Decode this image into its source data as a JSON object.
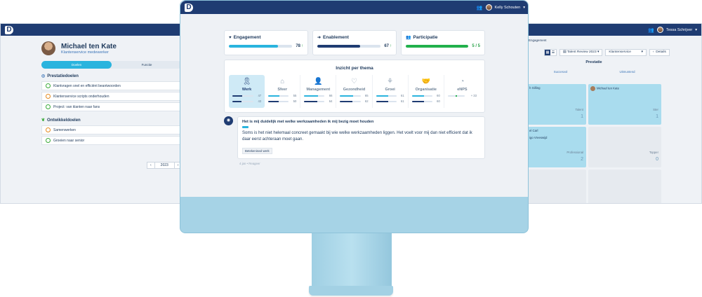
{
  "left": {
    "user_name": "Tessa Schrijver",
    "profile_name": "Michael ten Kate",
    "profile_role": "Klantenservice medewerker",
    "toggle": [
      "Doelen",
      "Functie"
    ],
    "sec1": "Prestatiedoelen",
    "goals1": [
      {
        "label": "Klantvragen snel en efficiënt beantwoorden",
        "mood": "green"
      },
      {
        "label": "Klantenservice scripts onderhouden",
        "mood": "orange"
      },
      {
        "label": "Project: van klanten naar fans",
        "mood": "green"
      }
    ],
    "sec2": "Ontwikkeldoelen",
    "goals2": [
      {
        "label": "Samenwerken",
        "mood": "orange"
      },
      {
        "label": "Groeien naar senior",
        "mood": "green"
      }
    ],
    "year": "2023"
  },
  "right": {
    "user_name": "Tessa Schrijver",
    "crumb": "Engagement",
    "review": "Talent Review 2023",
    "dept": "Klantenservice",
    "details": "Details",
    "title": "Prestatie",
    "cols": [
      "Succesvol",
      "Uitmuntend"
    ],
    "cells": [
      {
        "name": "h Gilling",
        "label": "Talent",
        "count": "1",
        "blue": true
      },
      {
        "name": "Michael ten Kate",
        "label": "Ster",
        "count": "1",
        "blue": true
      },
      {
        "name": "el Carl\n\nigo Vreeswijd",
        "label": "Professional",
        "count": "2",
        "blue": true
      },
      {
        "name": "",
        "label": "Topper",
        "count": "0",
        "blue": false
      },
      {
        "name": "",
        "label": "Gemiddelde medewerker",
        "count": "",
        "blue": false
      },
      {
        "name": "",
        "label": "Specialist",
        "count": "",
        "blue": false
      }
    ]
  },
  "main": {
    "user_name": "Kelly Schouten",
    "metrics": [
      {
        "title": "Engagement",
        "value": "78",
        "fraction": 0.78,
        "color": "#2ab4de",
        "icon": "heart-icon"
      },
      {
        "title": "Enablement",
        "value": "67",
        "fraction": 0.67,
        "color": "#1f3c72",
        "icon": "login-icon"
      },
      {
        "title": "Participatie",
        "value": "5 / 5",
        "fraction": 1.0,
        "color": "#22b14c",
        "icon": "people-icon"
      }
    ],
    "themes_title": "Inzicht per thema",
    "themes": [
      {
        "name": "Werk",
        "a": 47,
        "b": 43,
        "selected": true,
        "icon": "ribbon-icon"
      },
      {
        "name": "Sfeer",
        "a": 55,
        "b": 50,
        "selected": false,
        "icon": "home-icon"
      },
      {
        "name": "Management",
        "a": 66,
        "b": 64,
        "selected": false,
        "icon": "person-icon"
      },
      {
        "name": "Gezondheid",
        "a": 65,
        "b": 62,
        "selected": false,
        "icon": "heartbeat-icon"
      },
      {
        "name": "Groei",
        "a": 61,
        "b": 61,
        "selected": false,
        "icon": "growth-icon"
      },
      {
        "name": "Organisatie",
        "a": 60,
        "b": 60,
        "selected": false,
        "icon": "handshake-icon"
      },
      {
        "name": "eNPS",
        "value": "+ 33",
        "selected": false,
        "icon": "gauge-icon"
      }
    ],
    "comment_question": "Het is mij duidelijk met welke werkzaamheden ik mij bezig moet houden",
    "comment_score": 0.2,
    "comment_text": "Soms is het niet helemaal concreet gemaakt bij wie welke werkzaamheden liggen. Het voelt voor mij dan niet efficient dat ik daar eerst achteraan moet gaan.",
    "comment_tag": "Betekenisvol werk",
    "comment_meta": "4 jan • Reageer"
  }
}
